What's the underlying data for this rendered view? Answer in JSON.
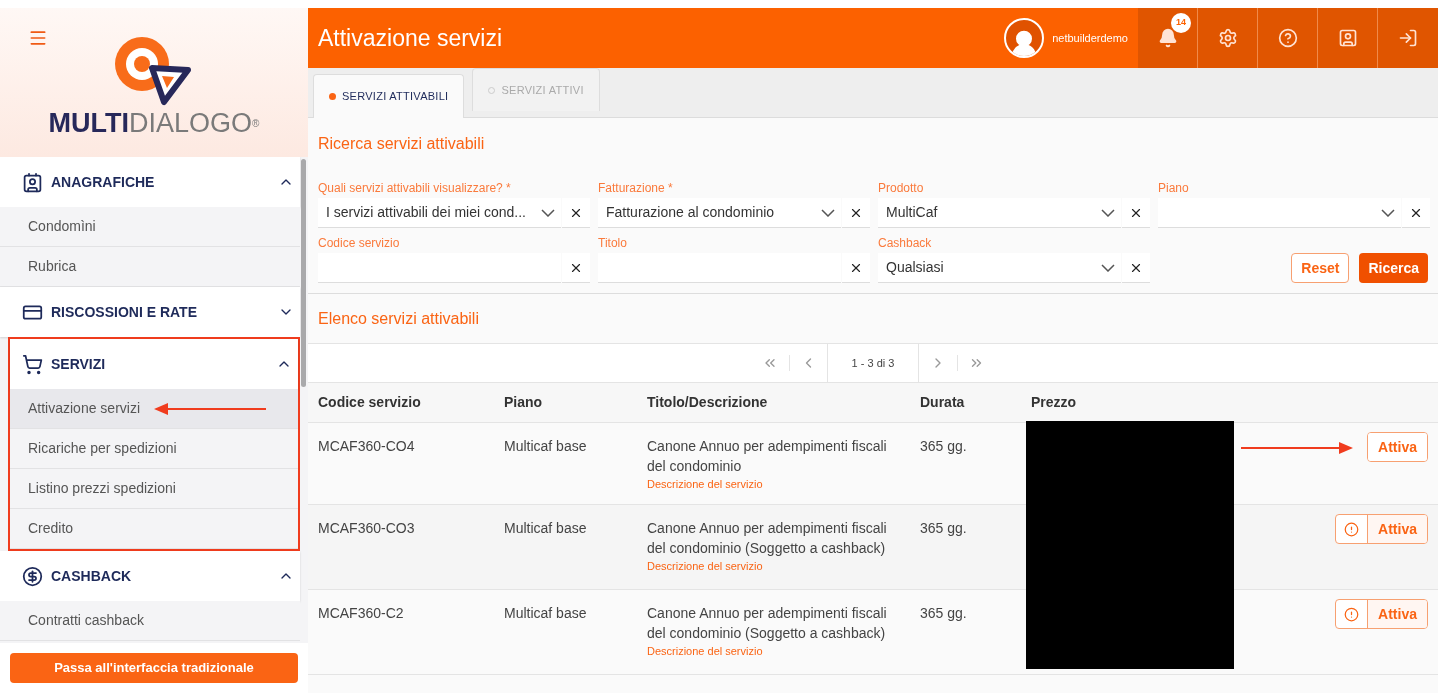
{
  "sidebar": {
    "logo": {
      "bold": "MULTI",
      "light": "DIALOGO",
      "mark": "®"
    },
    "sections": [
      {
        "title": "ANAGRAFICHE",
        "expanded": true,
        "highlighted": false,
        "items": [
          {
            "label": "Condomìni",
            "selected": false,
            "pointed": false
          },
          {
            "label": "Rubrica",
            "selected": false,
            "pointed": false
          }
        ]
      },
      {
        "title": "RISCOSSIONI E RATE",
        "expanded": false,
        "highlighted": false
      },
      {
        "title": "SERVIZI",
        "expanded": true,
        "highlighted": true,
        "items": [
          {
            "label": "Attivazione servizi",
            "selected": true,
            "pointed": true
          },
          {
            "label": "Ricariche per spedizioni",
            "selected": false,
            "pointed": false
          },
          {
            "label": "Listino prezzi spedizioni",
            "selected": false,
            "pointed": false
          },
          {
            "label": "Credito",
            "selected": false,
            "pointed": false
          }
        ]
      },
      {
        "title": "CASHBACK",
        "expanded": true,
        "highlighted": false,
        "items": [
          {
            "label": "Contratti cashback",
            "selected": false,
            "pointed": false
          }
        ]
      }
    ],
    "footer_button": "Passa all'interfaccia tradizionale"
  },
  "header": {
    "title": "Attivazione servizi",
    "user": "netbuilderdemo",
    "notifications": "14"
  },
  "tabs": [
    {
      "label": "SERVIZI ATTIVABILI",
      "selected": true
    },
    {
      "label": "SERVIZI ATTIVI",
      "selected": false
    }
  ],
  "search": {
    "title": "Ricerca servizi attivabili",
    "filters": [
      {
        "kind": "select",
        "label": "Quali servizi attivabili visualizzare? *",
        "value": "I servizi attivabili dei miei cond..."
      },
      {
        "kind": "select",
        "label": "Fatturazione *",
        "value": "Fatturazione al condominio"
      },
      {
        "kind": "select",
        "label": "Prodotto",
        "value": "MultiCaf"
      },
      {
        "kind": "select",
        "label": "Piano"
      },
      {
        "kind": "text",
        "label": "Codice servizio"
      },
      {
        "kind": "text",
        "label": "Titolo"
      },
      {
        "kind": "select",
        "label": "Cashback",
        "value": "Qualsiasi"
      }
    ],
    "buttons": [
      "Reset",
      "Ricerca"
    ]
  },
  "list": {
    "title": "Elenco servizi attivabili",
    "pagination": "1 - 3 di 3",
    "columns": [
      "Codice servizio",
      "Piano",
      "Titolo/Descrizione",
      "Durata",
      "Prezzo"
    ],
    "rows": [
      {
        "code": "MCAF360-CO4",
        "plan": "Multicaf base",
        "title": "Canone Annuo per adempimenti fiscali del condominio",
        "link": "Descrizione del servizio",
        "duration": "365 gg.",
        "warning": false,
        "pointed": true,
        "action": "Attiva"
      },
      {
        "code": "MCAF360-CO3",
        "plan": "Multicaf base",
        "title": "Canone Annuo per adempimenti fiscali del condominio (Soggetto a cashback)",
        "link": "Descrizione del servizio",
        "duration": "365 gg.",
        "warning": true,
        "pointed": false,
        "action": "Attiva"
      },
      {
        "code": "MCAF360-C2",
        "plan": "Multicaf base",
        "title": "Canone Annuo per adempimenti fiscali del condominio (Soggetto a cashback)",
        "link": "Descrizione del servizio",
        "duration": "365 gg.",
        "warning": true,
        "pointed": false,
        "action": "Attiva"
      }
    ]
  }
}
